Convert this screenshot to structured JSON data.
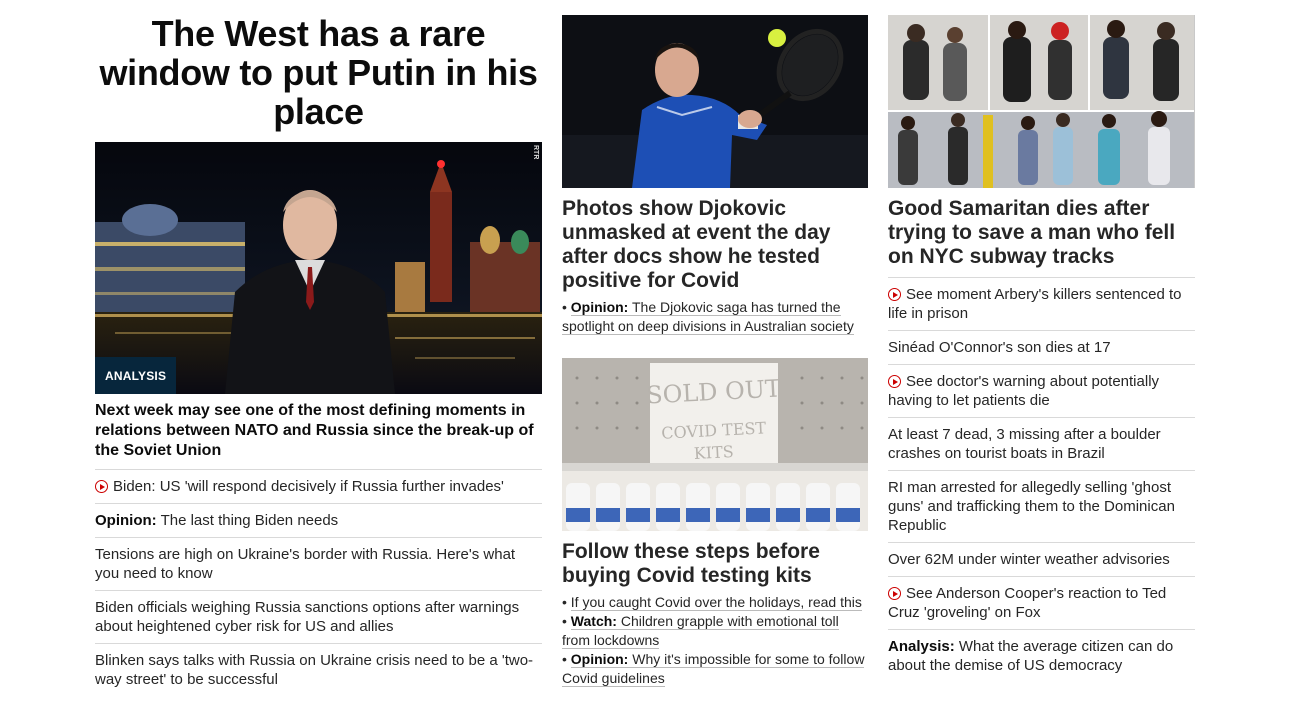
{
  "col1": {
    "headline": "The West has a rare window to put Putin in his place",
    "badge": "ANALYSIS",
    "photo_credit": "RTR",
    "subheadline": "Next week may see one of the most defining moments in relations between NATO and Russia since the break-up of the Soviet Union",
    "links": [
      {
        "video": true,
        "label": "",
        "text": "Biden: US 'will respond decisively if Russia further invades'"
      },
      {
        "video": false,
        "label": "Opinion:",
        "text": "The last thing Biden needs"
      },
      {
        "video": false,
        "label": "",
        "text": "Tensions are high on Ukraine's border with Russia. Here's what you need to know"
      },
      {
        "video": false,
        "label": "",
        "text": "Biden officials weighing Russia sanctions options after warnings about heightened cyber risk for US and allies"
      },
      {
        "video": false,
        "label": "",
        "text": "Blinken says talks with Russia on Ukraine crisis need to be a 'two-way street' to be successful"
      }
    ]
  },
  "col2": {
    "story1": {
      "title": "Photos show Djokovic unmasked at event the day after docs show he tested positive for Covid",
      "bullets": [
        {
          "label": "Opinion:",
          "text": "The Djokovic saga has turned the spotlight on deep divisions in Australian society"
        }
      ]
    },
    "story2": {
      "sign_text": "SOLD OUT COVID TEST KITS",
      "title": "Follow these steps before buying Covid testing kits",
      "bullets": [
        {
          "label": "",
          "text": "If you caught Covid over the holidays, read this"
        },
        {
          "label": "Watch:",
          "text": "Children grapple with emotional toll from lockdowns"
        },
        {
          "label": "Opinion:",
          "text": "Why it's impossible for some to follow Covid guidelines"
        }
      ]
    }
  },
  "col3": {
    "title": "Good Samaritan dies after trying to save a man who fell on NYC subway tracks",
    "links": [
      {
        "video": true,
        "label": "",
        "text": "See moment Arbery's killers sentenced to life in prison"
      },
      {
        "video": false,
        "label": "",
        "text": "Sinéad O'Connor's son dies at 17"
      },
      {
        "video": true,
        "label": "",
        "text": "See doctor's warning about potentially having to let patients die"
      },
      {
        "video": false,
        "label": "",
        "text": "At least 7 dead, 3 missing after a boulder crashes on tourist boats in Brazil"
      },
      {
        "video": false,
        "label": "",
        "text": "RI man arrested for allegedly selling 'ghost guns' and trafficking them to the Dominican Republic"
      },
      {
        "video": false,
        "label": "",
        "text": "Over 62M under winter weather advisories"
      },
      {
        "video": true,
        "label": "",
        "text": "See Anderson Cooper's reaction to Ted Cruz 'groveling' on Fox"
      },
      {
        "video": false,
        "label": "Analysis:",
        "text": "What the average citizen can do about the demise of US democracy"
      }
    ]
  },
  "colors": {
    "accent_red": "#cc0000",
    "badge_bg": "#07263c",
    "divider": "#d9d9d9"
  }
}
